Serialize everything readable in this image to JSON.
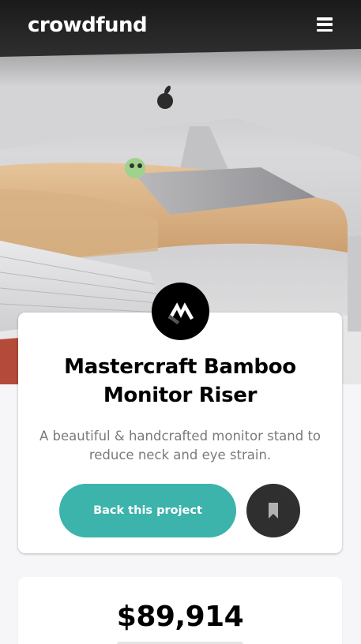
{
  "header": {
    "logo_text": "crowdfund",
    "menu_icon": "hamburger-icon"
  },
  "hero": {
    "image_description_icon": "hero-photo"
  },
  "project": {
    "logo_icon": "mastercraft-logo-icon",
    "title": "Mastercraft Bamboo Monitor Riser",
    "description": "A beautiful & handcrafted monitor stand to reduce neck and eye strain.",
    "back_button_label": "Back this project",
    "bookmark_icon": "bookmark-icon"
  },
  "stats": {
    "amount_backed": "$89,914"
  },
  "colors": {
    "accent": "#3cb3ab",
    "dark": "#2f2f2f"
  }
}
